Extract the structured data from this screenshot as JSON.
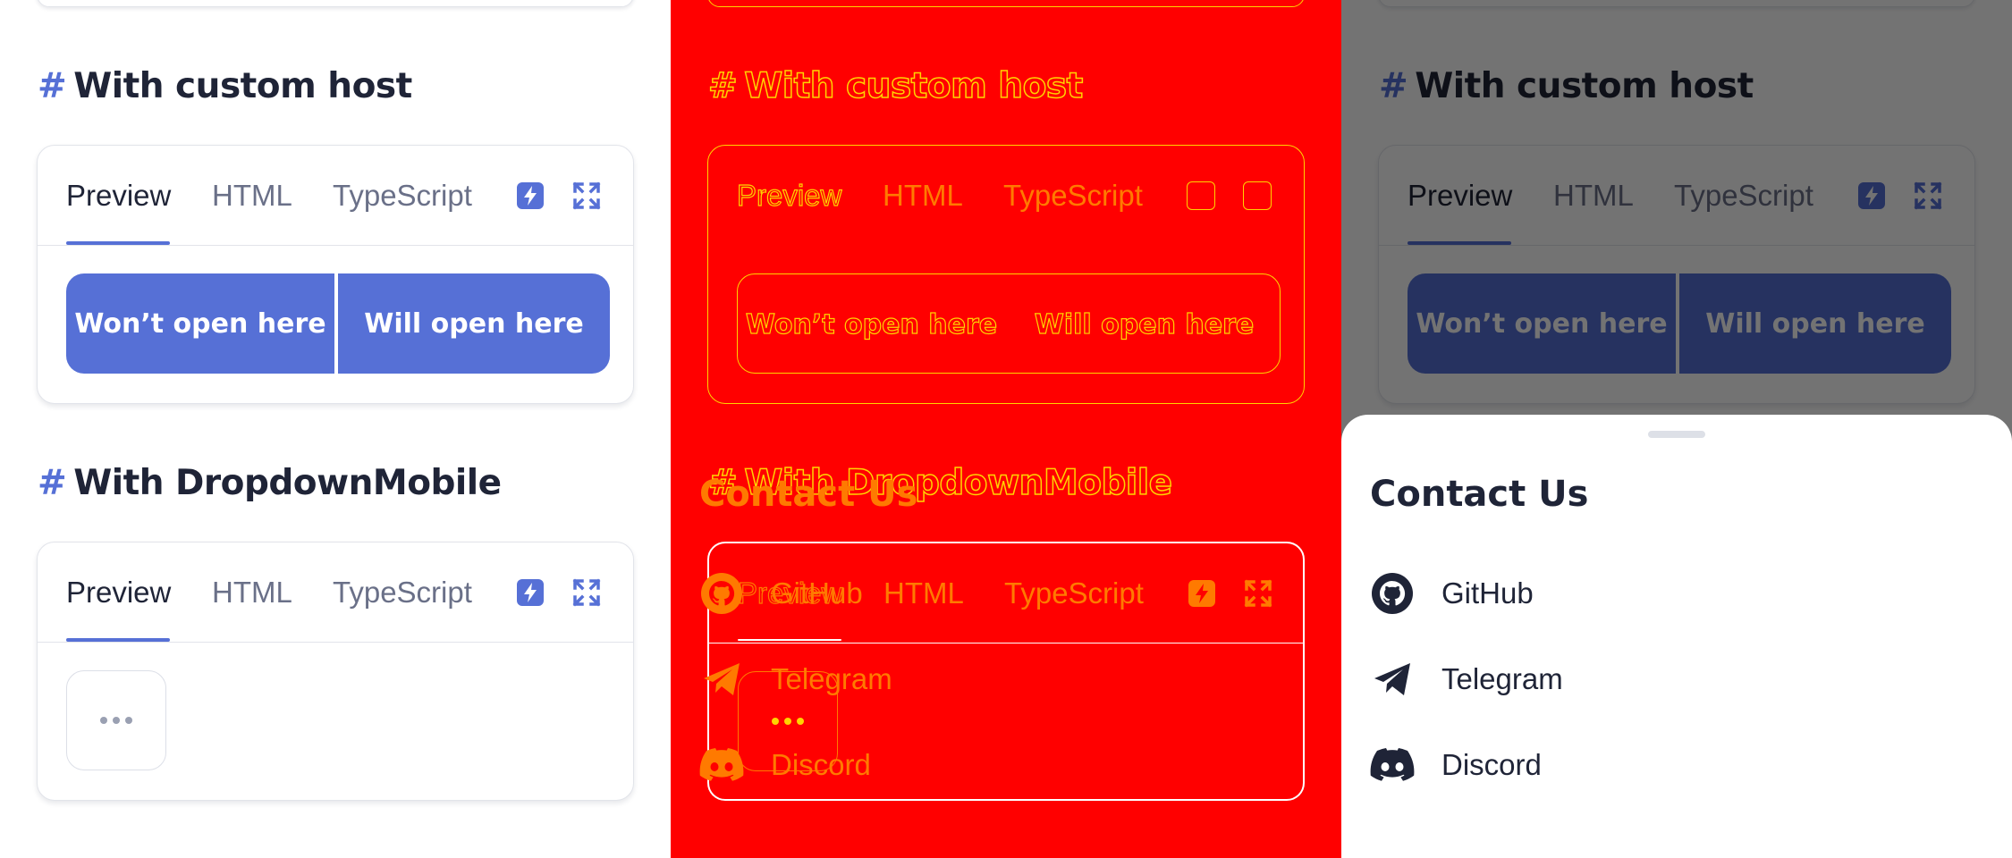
{
  "sections": [
    {
      "hash": "#",
      "title": "With custom host",
      "tabs": [
        "Preview",
        "HTML",
        "TypeScript"
      ],
      "buttons": [
        "Won’t open here",
        "Will open here"
      ]
    },
    {
      "hash": "#",
      "title": "With DropdownMobile",
      "tabs": [
        "Preview",
        "HTML",
        "TypeScript"
      ],
      "dropdown_trigger": "more-icon"
    }
  ],
  "tab_icons": [
    "lightning-icon",
    "expand-icon"
  ],
  "sheet": {
    "title": "Contact Us",
    "items": [
      {
        "label": "GitHub",
        "icon": "github-icon"
      },
      {
        "label": "Telegram",
        "icon": "telegram-icon"
      },
      {
        "label": "Discord",
        "icon": "discord-icon"
      }
    ]
  },
  "colors": {
    "accent": "#5670d6",
    "text": "#1f2437",
    "muted": "#6a7088",
    "debug_red": "#ff0000",
    "overlay": "rgba(0,0,0,0.55)"
  }
}
